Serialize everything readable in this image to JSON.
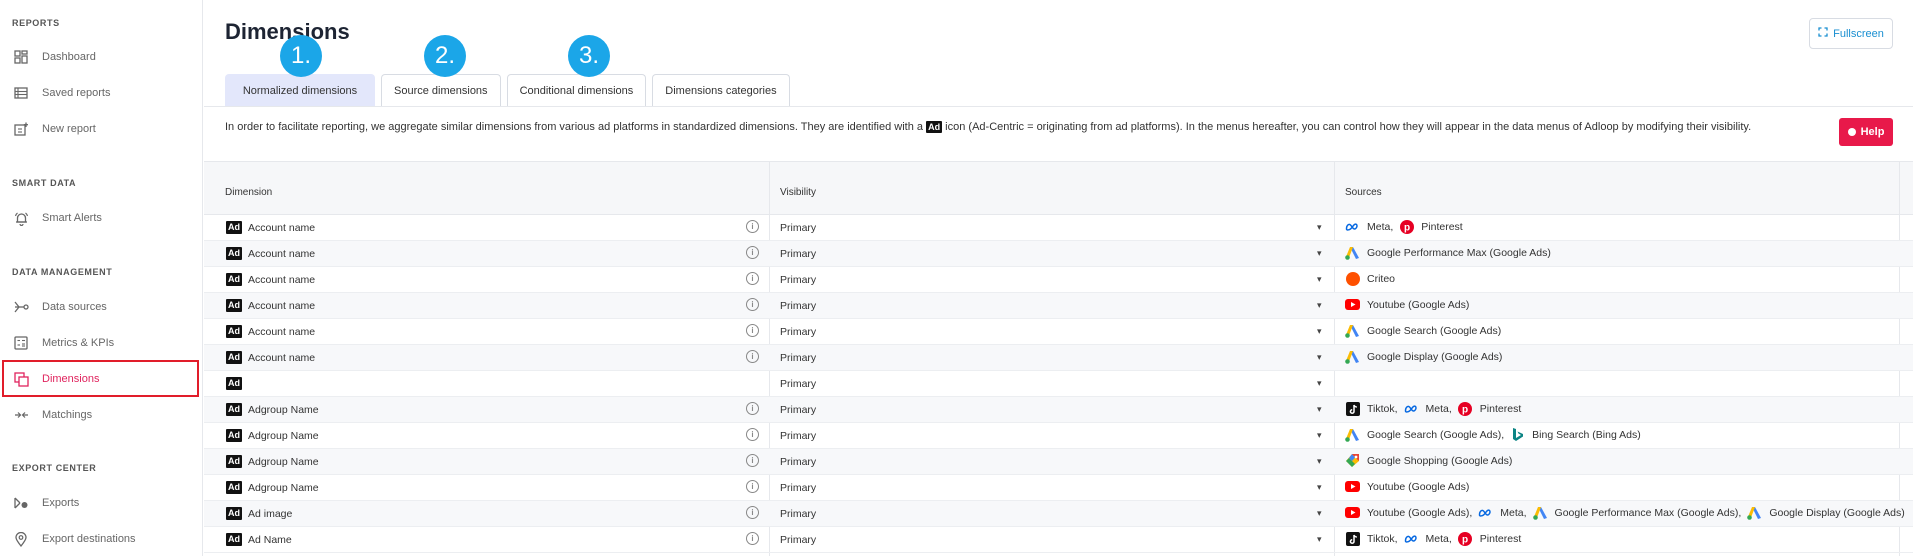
{
  "sidebar": {
    "sections": [
      {
        "title": "REPORTS",
        "items": [
          {
            "label": "Dashboard",
            "icon": "dashboard-icon"
          },
          {
            "label": "Saved reports",
            "icon": "saved-reports-icon"
          },
          {
            "label": "New report",
            "icon": "new-report-icon"
          }
        ]
      },
      {
        "title": "SMART DATA",
        "items": [
          {
            "label": "Smart Alerts",
            "icon": "bell-icon"
          }
        ]
      },
      {
        "title": "DATA MANAGEMENT",
        "items": [
          {
            "label": "Data sources",
            "icon": "data-sources-icon"
          },
          {
            "label": "Metrics & KPIs",
            "icon": "calculator-icon"
          },
          {
            "label": "Dimensions",
            "icon": "dimensions-icon",
            "active": true
          },
          {
            "label": "Matchings",
            "icon": "matchings-icon"
          }
        ]
      },
      {
        "title": "EXPORT CENTER",
        "items": [
          {
            "label": "Exports",
            "icon": "exports-icon"
          },
          {
            "label": "Export destinations",
            "icon": "location-pin-icon"
          }
        ]
      }
    ]
  },
  "header": {
    "title": "Dimensions",
    "fullscreen_label": "Fullscreen"
  },
  "tabs": [
    {
      "label": "Normalized dimensions",
      "active": true,
      "annotation": "1."
    },
    {
      "label": "Source dimensions",
      "annotation": "2."
    },
    {
      "label": "Conditional dimensions",
      "annotation": "3."
    },
    {
      "label": "Dimensions categories"
    }
  ],
  "info": {
    "text_before": "In order to facilitate reporting, we aggregate similar dimensions from various ad platforms in standardized dimensions. They are identified with a",
    "badge": "Ad",
    "text_after": "icon (Ad-Centric = originating from ad platforms). In the menus hereafter, you can control how they will appear in the data menus of Adloop by modifying their visibility.",
    "help_label": "Help"
  },
  "table": {
    "columns": [
      "Dimension",
      "Visibility",
      "Sources"
    ],
    "badge": "Ad",
    "info_glyph": "i",
    "caret_glyph": "▾",
    "rows": [
      {
        "name": "Account name",
        "visibility": "Primary",
        "sources": [
          {
            "icon": "meta-icon",
            "label": "Meta,"
          },
          {
            "icon": "pinterest-icon",
            "label": "Pinterest"
          }
        ]
      },
      {
        "name": "Account name",
        "visibility": "Primary",
        "sources": [
          {
            "icon": "google-ads-icon",
            "label": "Google Performance Max (Google Ads)"
          }
        ]
      },
      {
        "name": "Account name",
        "visibility": "Primary",
        "sources": [
          {
            "icon": "criteo-icon",
            "label": "Criteo"
          }
        ]
      },
      {
        "name": "Account name",
        "visibility": "Primary",
        "sources": [
          {
            "icon": "youtube-icon",
            "label": "Youtube (Google Ads)"
          }
        ]
      },
      {
        "name": "Account name",
        "visibility": "Primary",
        "sources": [
          {
            "icon": "google-ads-icon",
            "label": "Google Search (Google Ads)"
          }
        ]
      },
      {
        "name": "Account name",
        "visibility": "Primary",
        "sources": [
          {
            "icon": "google-ads-icon",
            "label": "Google Display (Google Ads)"
          }
        ]
      },
      {
        "name": "",
        "visibility": "Primary",
        "sources": [],
        "no_info": true
      },
      {
        "name": "Adgroup Name",
        "visibility": "Primary",
        "sources": [
          {
            "icon": "tiktok-icon",
            "label": "Tiktok,"
          },
          {
            "icon": "meta-icon",
            "label": "Meta,"
          },
          {
            "icon": "pinterest-icon",
            "label": "Pinterest"
          }
        ]
      },
      {
        "name": "Adgroup Name",
        "visibility": "Primary",
        "sources": [
          {
            "icon": "google-ads-icon",
            "label": "Google Search (Google Ads),"
          },
          {
            "icon": "bing-icon",
            "label": "Bing Search (Bing Ads)"
          }
        ]
      },
      {
        "name": "Adgroup Name",
        "visibility": "Primary",
        "sources": [
          {
            "icon": "google-shopping-icon",
            "label": "Google Shopping (Google Ads)"
          }
        ]
      },
      {
        "name": "Adgroup Name",
        "visibility": "Primary",
        "sources": [
          {
            "icon": "youtube-icon",
            "label": "Youtube (Google Ads)"
          }
        ]
      },
      {
        "name": "Ad image",
        "visibility": "Primary",
        "sources": [
          {
            "icon": "youtube-icon",
            "label": "Youtube (Google Ads),"
          },
          {
            "icon": "meta-icon",
            "label": "Meta,"
          },
          {
            "icon": "google-ads-icon",
            "label": "Google Performance Max (Google Ads),"
          },
          {
            "icon": "google-ads-icon",
            "label": "Google Display (Google Ads)"
          }
        ]
      },
      {
        "name": "Ad Name",
        "visibility": "Primary",
        "sources": [
          {
            "icon": "tiktok-icon",
            "label": "Tiktok,"
          },
          {
            "icon": "meta-icon",
            "label": "Meta,"
          },
          {
            "icon": "pinterest-icon",
            "label": "Pinterest"
          }
        ]
      }
    ]
  },
  "colors": {
    "accent": "#1a8fd1",
    "active_nav": "#e0245e",
    "help": "#e8194a",
    "annotation": "#1ba6e8",
    "highlight": "#e11d2a"
  }
}
